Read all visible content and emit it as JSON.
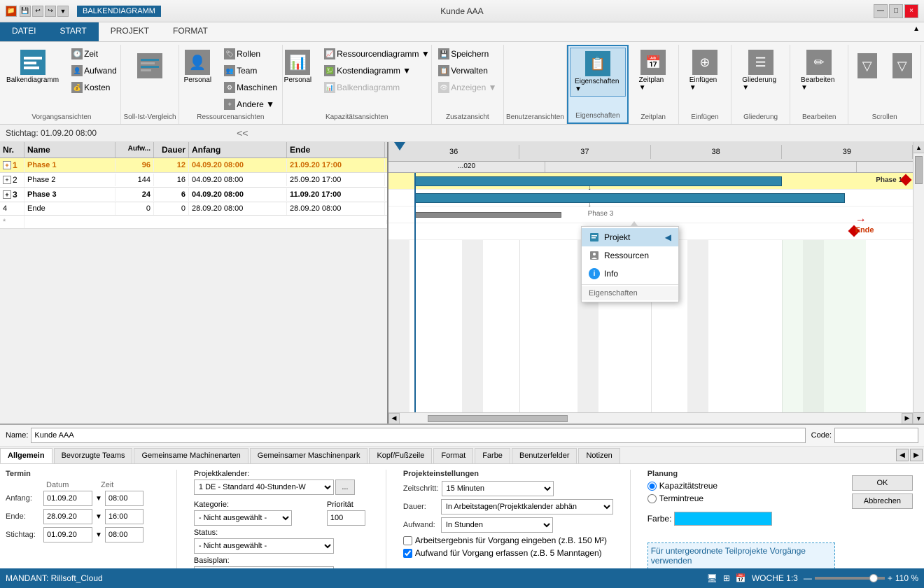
{
  "titleBar": {
    "leftSection": "BALKENDIAGRAMM",
    "title": "Kunde AAA",
    "windowControls": [
      "—",
      "□",
      "×"
    ]
  },
  "ribbon": {
    "tabs": [
      "DATEI",
      "START",
      "PROJEKT",
      "FORMAT"
    ],
    "activeTab": "START",
    "groups": {
      "vorgangsansichten": {
        "label": "Vorgangsansichten",
        "buttons": [
          {
            "id": "balkendiagramm",
            "label": "Balkendiagramm",
            "icon": "bar-chart"
          }
        ],
        "smallButtons": [
          {
            "label": "Zeit"
          },
          {
            "label": "Aufwand"
          },
          {
            "label": "Kosten"
          }
        ]
      },
      "sollIst": {
        "label": "Soll-Ist-Vergleich"
      },
      "ressourcen": {
        "label": "Ressourcenansichten",
        "buttons": [
          "Rollen",
          "Team",
          "Maschinen",
          "Andere"
        ],
        "subLabel": "Personal"
      },
      "kapazitaet": {
        "label": "Kapazitätsansichten",
        "buttons": [
          "Personal"
        ],
        "sub": [
          "Ressourcendiagramm",
          "Kostendiagramm",
          "Balkendiagramm"
        ]
      },
      "zusatz": {
        "label": "Zusatzansicht",
        "buttons": [
          "Speichern",
          "Verwalten",
          "Anzeigen"
        ]
      },
      "benutzer": {
        "label": "Benutzeransichten"
      },
      "eigenschaften": {
        "label": "Eigenschaften",
        "active": true
      },
      "zeitplan": {
        "label": "Zeitplan"
      },
      "einfuegen": {
        "label": "Einfügen"
      },
      "gliederung": {
        "label": "Gliederung"
      },
      "bearbeiten": {
        "label": "Bearbeiten"
      },
      "scrollen": {
        "label": "Scrollen"
      }
    }
  },
  "ganttHeader": {
    "stichtag": "Stichtag: 01.09.20 08:00",
    "chevron": "<<"
  },
  "tableColumns": [
    "Nr.",
    "Name",
    "Aufwand",
    "Dauer",
    "Anfang",
    "Ende"
  ],
  "tableRows": [
    {
      "nr": "1",
      "name": "Phase 1",
      "aufwand": "96",
      "dauer": "12",
      "anfang": "04.09.20 08:00",
      "ende": "21.09.20 17:00",
      "highlight": true,
      "bold": true,
      "expand": true
    },
    {
      "nr": "2",
      "name": "Phase 2",
      "aufwand": "144",
      "dauer": "16",
      "anfang": "04.09.20 08:00",
      "ende": "25.09.20 17:00",
      "highlight": false,
      "bold": false,
      "expand": true
    },
    {
      "nr": "3",
      "name": "Phase 3",
      "aufwand": "24",
      "dauer": "6",
      "anfang": "04.09.20 08:00",
      "ende": "11.09.20 17:00",
      "highlight": false,
      "bold": true,
      "expand": true
    },
    {
      "nr": "4",
      "name": "Ende",
      "aufwand": "0",
      "dauer": "0",
      "anfang": "28.09.20 08:00",
      "ende": "28.09.20 08:00",
      "highlight": false,
      "bold": false,
      "expand": false
    },
    {
      "nr": "*",
      "name": "",
      "aufwand": "",
      "dauer": "",
      "anfang": "",
      "ende": "",
      "highlight": false,
      "star": true
    }
  ],
  "ganttScale": {
    "weeks": [
      "36",
      "37",
      "38",
      "39"
    ]
  },
  "dropdownMenu": {
    "title": "Eigenschaften",
    "items": [
      {
        "id": "projekt",
        "label": "Projekt",
        "icon": "project",
        "active": true
      },
      {
        "id": "ressourcen",
        "label": "Ressourcen",
        "icon": "resource"
      },
      {
        "id": "info",
        "label": "Info",
        "icon": "info"
      }
    ],
    "footer": "Eigenschaften"
  },
  "bottomPanel": {
    "nameLabel": "Name:",
    "nameValue": "Kunde AAA",
    "codeLabel": "Code:",
    "codeValue": "",
    "tabs": [
      "Allgemein",
      "Bevorzugte Teams",
      "Gemeinsame Machinenarten",
      "Gemeinsamer Maschinenpark",
      "Kopf/Fußzeile",
      "Format",
      "Farbe",
      "Benutzerfelder",
      "Notizen"
    ],
    "activeTab": "Allgemein"
  },
  "formSection": {
    "termin": {
      "title": "Termin",
      "rows": [
        {
          "label": "Anfang:",
          "date": "01.09.20",
          "time": "08:00"
        },
        {
          "label": "Ende:",
          "date": "28.09.20",
          "time": "16:00"
        },
        {
          "label": "Stichtag:",
          "date": "01.09.20",
          "time": "08:00"
        }
      ]
    },
    "projektkalender": {
      "label": "Projektkalender:",
      "value": "1 DE - Standard 40-Stunden-W",
      "btnLabel": "..."
    },
    "kategorie": {
      "label": "Kategorie:",
      "value": "- Nicht ausgewählt -"
    },
    "prioritaet": {
      "label": "Priorität",
      "value": "100"
    },
    "status": {
      "label": "Status:",
      "value": "- Nicht ausgewählt -"
    },
    "basisplan": {
      "label": "Basisplan:",
      "value": ""
    },
    "projekteinstellungen": {
      "title": "Projekteinstellungen",
      "zeitschritt": {
        "label": "Zeitschritt:",
        "value": "15 Minuten"
      },
      "dauer": {
        "label": "Dauer:",
        "value": "In Arbeitstagen(Projektkalender abhän"
      },
      "aufwand": {
        "label": "Aufwand:",
        "value": "In Stunden"
      },
      "check1": "Arbeitsergebnis für Vorgang eingeben (z.B. 150 M²)",
      "check2": "Aufwand für Vorgang erfassen (z.B. 5 Manntagen)"
    },
    "planung": {
      "title": "Planung",
      "options": [
        "Kapazitätstreue",
        "Termintreue"
      ],
      "activeOption": "Kapazitätstreue",
      "farbe": {
        "label": "Farbe:"
      }
    }
  },
  "statusBar": {
    "left": "MANDANT: Rillsoft_Cloud",
    "right": "WOCHE 1:3",
    "zoom": "110 %",
    "icons": [
      "monitor",
      "grid",
      "calendar"
    ]
  },
  "buttons": {
    "ok": "OK",
    "abbrechen": "Abbrechen"
  }
}
